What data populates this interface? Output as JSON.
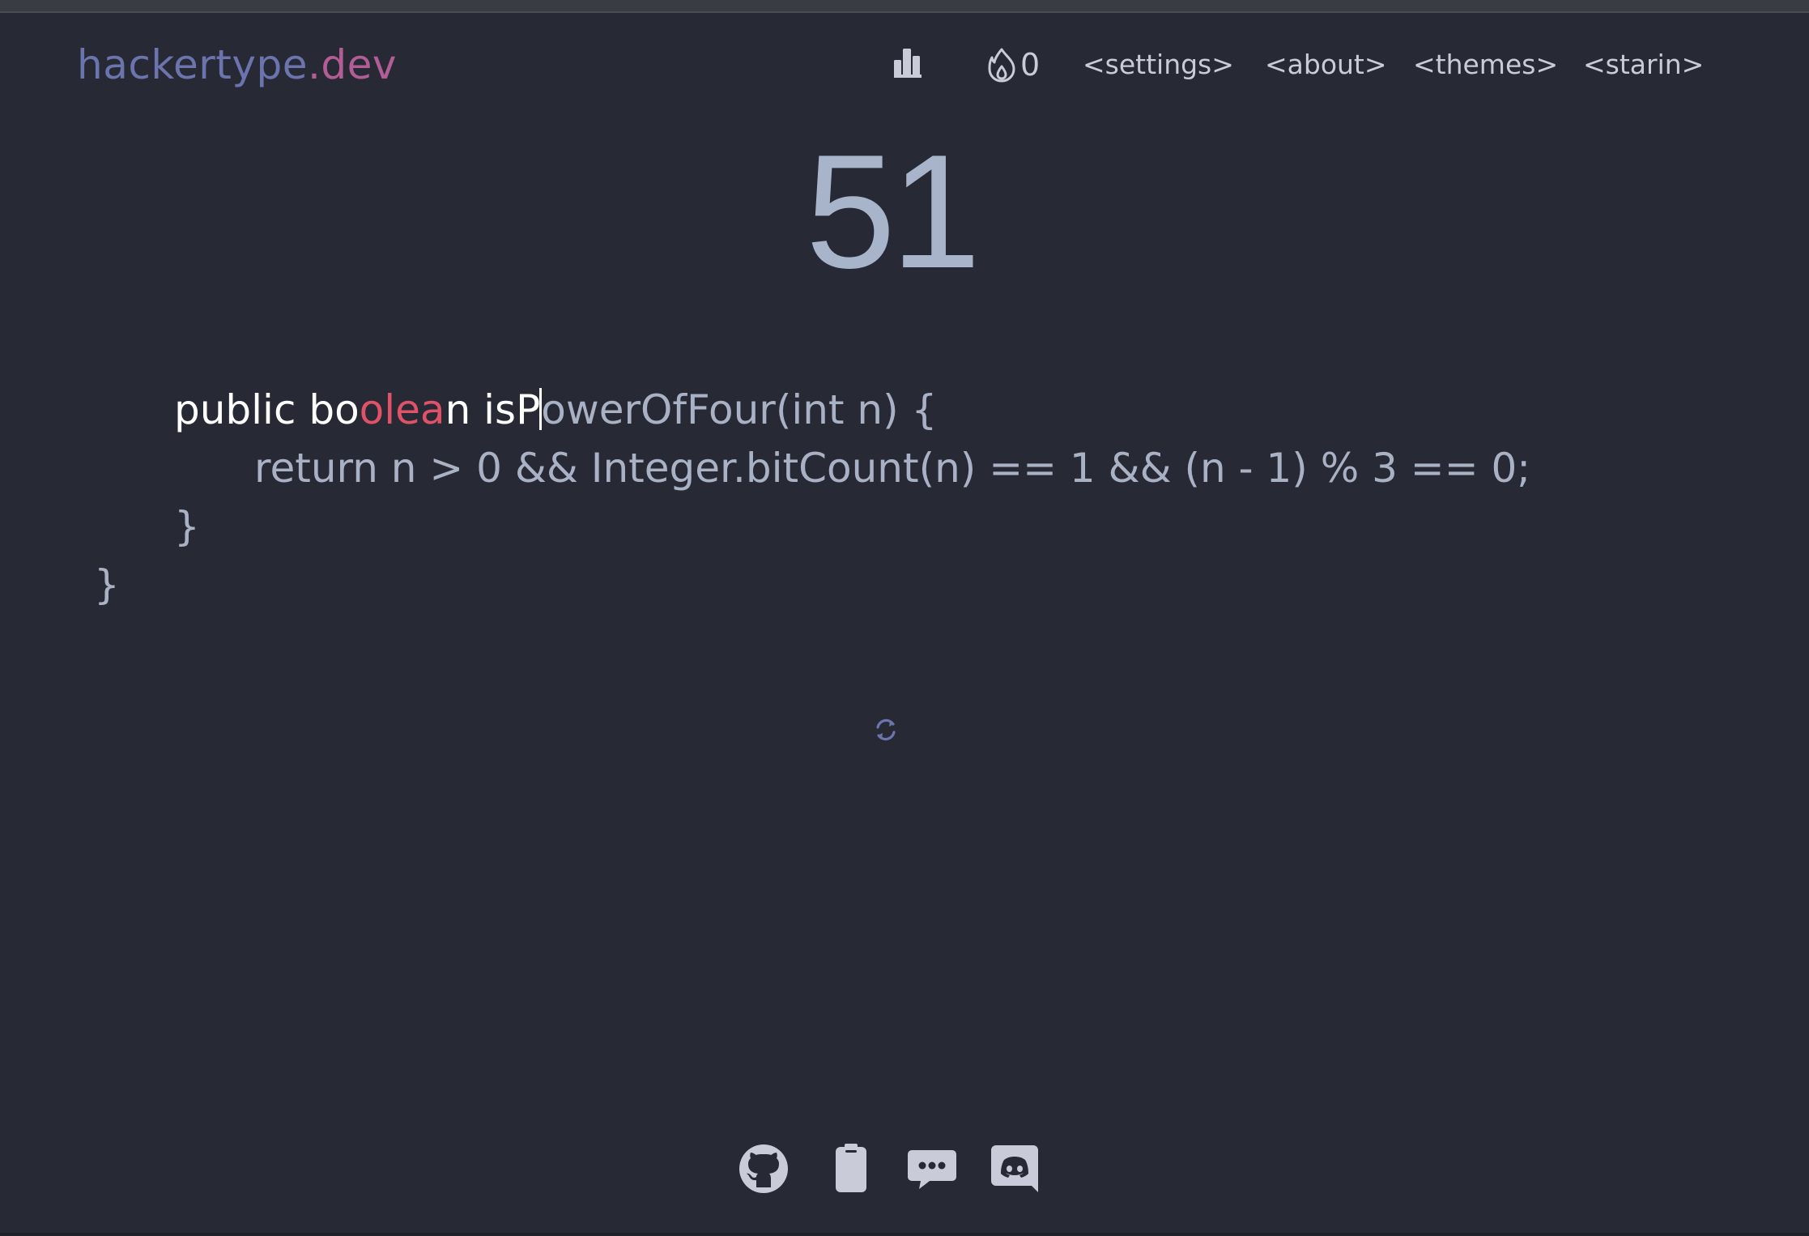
{
  "header": {
    "logo_main": "hackertype",
    "logo_tld": ".dev",
    "stats_icon": "bar-chart-icon",
    "streak_icon": "flame-icon",
    "streak_count": "0",
    "nav": [
      {
        "label": "<settings>"
      },
      {
        "label": "<about>"
      },
      {
        "label": "<themes>"
      },
      {
        "label": "<starin>"
      }
    ]
  },
  "counter": {
    "value": "51"
  },
  "code": {
    "line1": {
      "typed_a": "public bo",
      "typed_err": "olea",
      "typed_b": "n isP",
      "pending": "owerOfFour(int n) {"
    },
    "line2": "return n > 0 && Integer.bitCount(n) == 1 && (n - 1) % 3 == 0;",
    "line3": "}",
    "line4": "}"
  },
  "restart": {
    "icon": "restart-icon"
  },
  "footer": {
    "icons": [
      "github-icon",
      "clipboard-icon",
      "chat-icon",
      "discord-icon"
    ]
  },
  "colors": {
    "background": "#272a35",
    "logo_main": "#6b74ad",
    "logo_tld": "#b35d96",
    "typed": "#ffffff",
    "error": "#e05267",
    "pending": "#a9b1c4",
    "counter": "#a7b4c9"
  }
}
